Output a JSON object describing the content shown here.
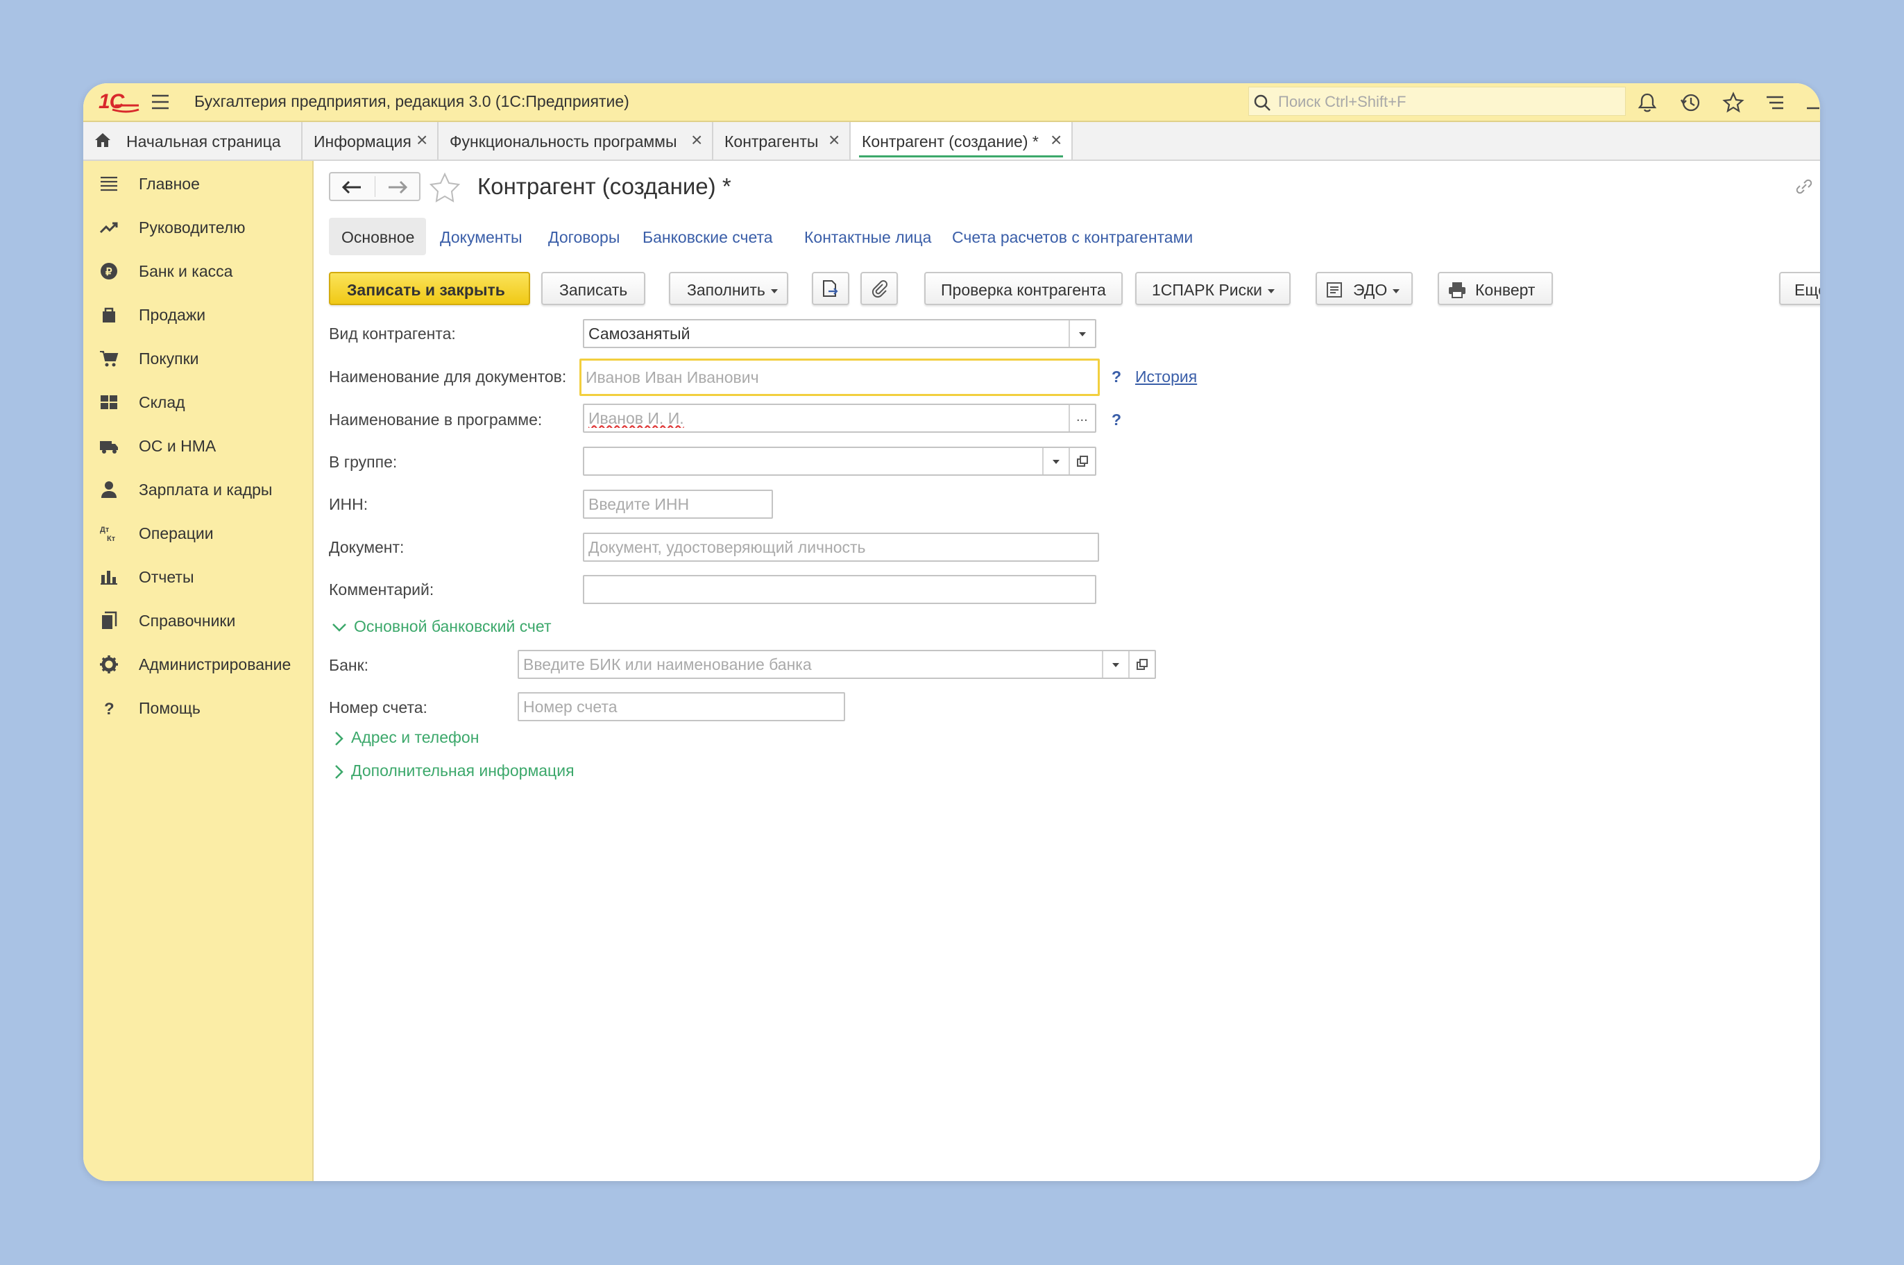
{
  "app": {
    "title": "Бухгалтерия предприятия, редакция 3.0  (1С:Предприятие)",
    "logo": "1С",
    "search_placeholder": "Поиск Ctrl+Shift+F"
  },
  "tabs": [
    {
      "label": "Начальная страница"
    },
    {
      "label": "Информация",
      "close": "×"
    },
    {
      "label": "Функциональность программы",
      "close": "×"
    },
    {
      "label": "Контрагенты",
      "close": "×"
    },
    {
      "label": "Контрагент (создание) *",
      "close": "×"
    }
  ],
  "sidebar": {
    "items": [
      {
        "label": "Главное",
        "icon": "menu-icon"
      },
      {
        "label": "Руководителю",
        "icon": "trend-icon"
      },
      {
        "label": "Банк и касса",
        "icon": "coin-icon"
      },
      {
        "label": "Продажи",
        "icon": "bag-icon"
      },
      {
        "label": "Покупки",
        "icon": "cart-icon"
      },
      {
        "label": "Склад",
        "icon": "grid-icon"
      },
      {
        "label": "ОС и НМА",
        "icon": "truck-icon"
      },
      {
        "label": "Зарплата и кадры",
        "icon": "person-icon"
      },
      {
        "label": "Операции",
        "icon": "dt-kt-icon"
      },
      {
        "label": "Отчеты",
        "icon": "bars-icon"
      },
      {
        "label": "Справочники",
        "icon": "book-icon"
      },
      {
        "label": "Администрирование",
        "icon": "gear-icon"
      },
      {
        "label": "Помощь",
        "icon": "question-icon"
      }
    ]
  },
  "form": {
    "title": "Контрагент (создание) *",
    "subtabs": [
      "Основное",
      "Документы",
      "Договоры",
      "Банковские счета",
      "Контактные лица",
      "Счета расчетов с контрагентами"
    ],
    "toolbar": {
      "save_close": "Записать и закрыть",
      "save": "Записать",
      "fill": "Заполнить",
      "check": "Проверка контрагента",
      "spark": "1СПАРК Риски",
      "edo": "ЭДО",
      "envelope": "Конверт",
      "more": "Ещё"
    },
    "fields": {
      "kind_label": "Вид контрагента:",
      "kind_value": "Самозанятый",
      "doc_name_label": "Наименование для документов:",
      "doc_name_placeholder": "Иванов Иван Иванович",
      "history": "История",
      "prog_name_label": "Наименование в программе:",
      "prog_name_placeholder": "Иванов И. И.",
      "ellipsis": "...",
      "group_label": "В группе:",
      "inn_label": "ИНН:",
      "inn_placeholder": "Введите ИНН",
      "document_label": "Документ:",
      "document_placeholder": "Документ, удостоверяющий личность",
      "comment_label": "Комментарий:",
      "help": "?"
    },
    "bank_group": {
      "title": "Основной банковский счет",
      "bank_label": "Банк:",
      "bank_placeholder": "Введите БИК или наименование банка",
      "account_label": "Номер счета:",
      "account_placeholder": "Номер счета"
    },
    "collapsed_groups": [
      "Адрес и телефон",
      "Дополнительная информация"
    ]
  }
}
